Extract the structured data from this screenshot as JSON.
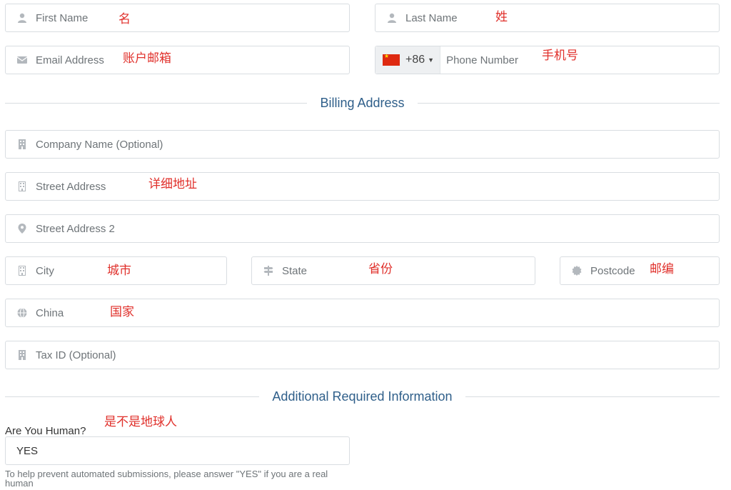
{
  "fields": {
    "first_name": "First Name",
    "last_name": "Last Name",
    "email": "Email Address",
    "phone": {
      "dial_code": "+86",
      "placeholder": "Phone Number"
    },
    "company": "Company Name (Optional)",
    "street": "Street Address",
    "street2": "Street Address 2",
    "city": "City",
    "state": "State",
    "postcode": "Postcode",
    "country": "China",
    "tax_id": "Tax ID (Optional)"
  },
  "sections": {
    "billing": "Billing Address",
    "additional": "Additional Required Information"
  },
  "human": {
    "label": "Are You Human?",
    "value": "YES",
    "help": "To help prevent automated submissions, please answer \"YES\" if you are a real human"
  },
  "notes": {
    "first_name": "名",
    "last_name": "姓",
    "email": "账户邮箱",
    "phone": "手机号",
    "street": "详细地址",
    "city": "城市",
    "state": "省份",
    "postcode": "邮编",
    "country": "国家",
    "human": "是不是地球人"
  },
  "colors": {
    "annotation": "#e0302b",
    "section_title": "#2f5f8a",
    "border": "#d9dde1"
  }
}
